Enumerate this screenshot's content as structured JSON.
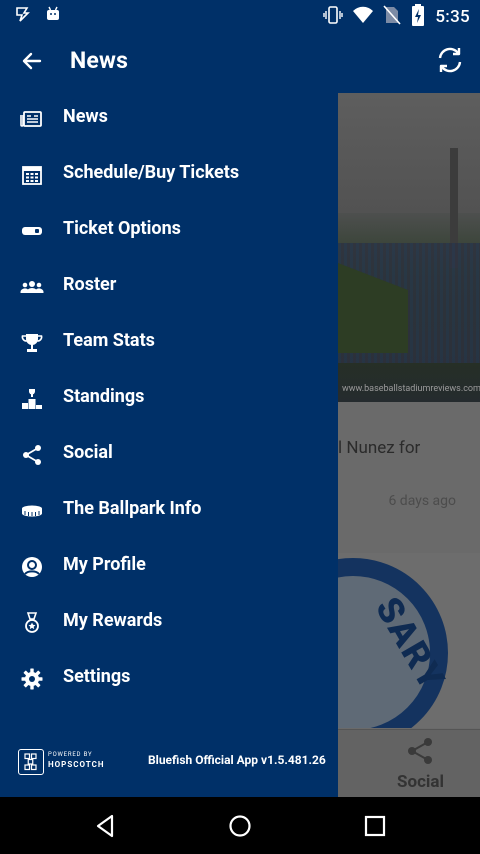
{
  "status_bar": {
    "time": "5:35",
    "left_icons": [
      "hopscotch-notify-icon",
      "android-icon"
    ],
    "right_icons": [
      "vibrate-icon",
      "wifi-icon",
      "no-sim-icon",
      "battery-icon"
    ]
  },
  "app_bar": {
    "title": "News",
    "back_icon": "arrow-back-icon",
    "refresh_icon": "refresh-icon"
  },
  "drawer": {
    "items": [
      {
        "label": "News",
        "icon": "news-icon"
      },
      {
        "label": "Schedule/Buy Tickets",
        "icon": "calendar-icon"
      },
      {
        "label": "Ticket Options",
        "icon": "ticket-icon"
      },
      {
        "label": "Roster",
        "icon": "group-icon"
      },
      {
        "label": "Team Stats",
        "icon": "trophy-icon"
      },
      {
        "label": "Standings",
        "icon": "podium-icon"
      },
      {
        "label": "Social",
        "icon": "share-icon"
      },
      {
        "label": "The Ballpark Info",
        "icon": "stadium-icon"
      },
      {
        "label": "My Profile",
        "icon": "profile-icon"
      },
      {
        "label": "My Rewards",
        "icon": "medal-icon"
      },
      {
        "label": "Settings",
        "icon": "gear-icon"
      }
    ],
    "footer": {
      "powered_by": "POWERED BY",
      "brand": "HOPSCOTCH",
      "version": "Bluefish Official App v1.5.481.26"
    }
  },
  "background": {
    "watermark": "www.baseballstadiumreviews.com",
    "article_snippet": "l Nunez for",
    "article_date": "6 days ago",
    "logo_text": "SARY",
    "bottom_tab_label": "Social"
  },
  "colors": {
    "primary": "#003068",
    "scrim_bg": "#6a6a6a"
  }
}
